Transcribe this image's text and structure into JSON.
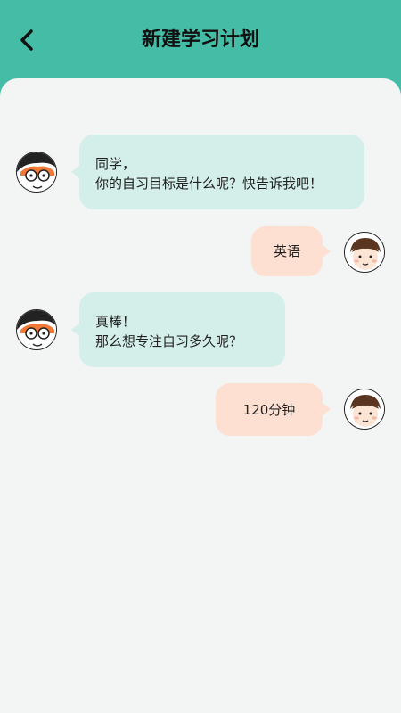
{
  "header": {
    "title": "新建学习计划",
    "back_icon": "chevron-left-icon"
  },
  "colors": {
    "header_bg": "#45bca6",
    "content_bg": "#f3f5f4",
    "bot_bubble": "#d4efea",
    "user_bubble": "#fde0d2"
  },
  "messages": [
    {
      "sender": "bot",
      "lines": [
        "同学，",
        "你的自习目标是什么呢？快告诉我吧！"
      ]
    },
    {
      "sender": "user",
      "text": "英语"
    },
    {
      "sender": "bot",
      "lines": [
        "真棒！",
        "那么想专注自习多久呢？"
      ]
    },
    {
      "sender": "user",
      "text": "120分钟"
    }
  ]
}
